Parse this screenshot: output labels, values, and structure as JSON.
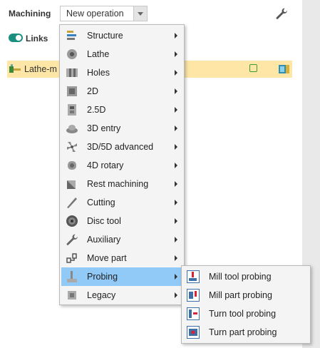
{
  "toolbar": {
    "title": "Machining",
    "operation_combo": "New operation"
  },
  "links": {
    "label": "Links",
    "enabled": true
  },
  "tree": {
    "row_label": "Lathe-m",
    "highlight_color": "#fde6a6"
  },
  "menu": {
    "active_color": "#91c9f7",
    "items": [
      {
        "label": "Structure",
        "icon": "structure-icon"
      },
      {
        "label": "Lathe",
        "icon": "lathe-icon"
      },
      {
        "label": "Holes",
        "icon": "holes-icon"
      },
      {
        "label": "2D",
        "icon": "2d-icon"
      },
      {
        "label": "2.5D",
        "icon": "2-5d-icon"
      },
      {
        "label": "3D entry",
        "icon": "3d-entry-icon"
      },
      {
        "label": "3D/5D advanced",
        "icon": "3d-5d-advanced-icon"
      },
      {
        "label": "4D rotary",
        "icon": "4d-rotary-icon"
      },
      {
        "label": "Rest machining",
        "icon": "rest-machining-icon"
      },
      {
        "label": "Cutting",
        "icon": "cutting-icon"
      },
      {
        "label": "Disc tool",
        "icon": "disc-tool-icon"
      },
      {
        "label": "Auxiliary",
        "icon": "auxiliary-icon"
      },
      {
        "label": "Move part",
        "icon": "move-part-icon"
      },
      {
        "label": "Probing",
        "icon": "probing-icon"
      },
      {
        "label": "Legacy",
        "icon": "legacy-icon"
      }
    ]
  },
  "submenu": {
    "items": [
      {
        "label": "Mill tool probing",
        "icon": "mill-tool-probing-icon"
      },
      {
        "label": "Mill part probing",
        "icon": "mill-part-probing-icon"
      },
      {
        "label": "Turn tool probing",
        "icon": "turn-tool-probing-icon"
      },
      {
        "label": "Turn part probing",
        "icon": "turn-part-probing-icon"
      }
    ]
  }
}
